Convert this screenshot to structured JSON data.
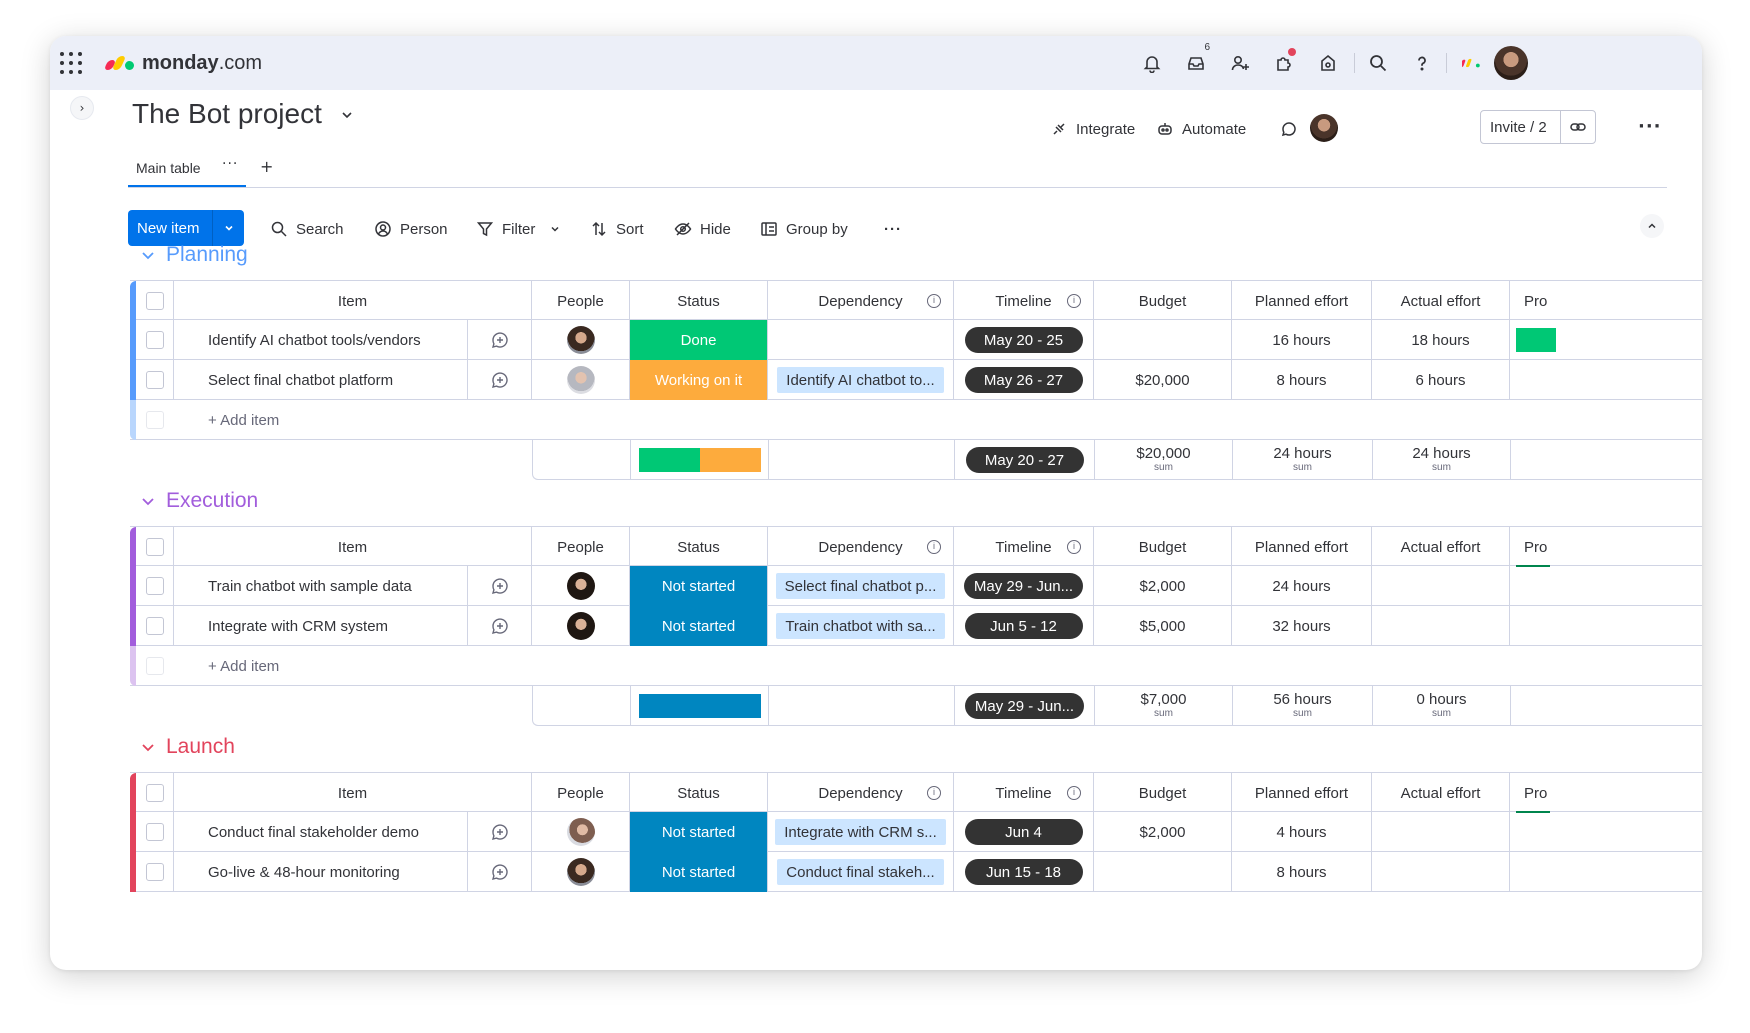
{
  "app": {
    "logo_text_bold": "monday",
    "logo_text_light": ".com",
    "inbox_badge": "6",
    "colors": {
      "brand_blue": "#0073ea",
      "done": "#00c875",
      "working": "#fdab3d",
      "not_started": "#0086c0"
    }
  },
  "board": {
    "title": "The Bot project",
    "tab_main": "Main table",
    "tab_dots": "···",
    "tab_add": "+",
    "integrate": "Integrate",
    "automate": "Automate",
    "invite": "Invite / 2",
    "more": "···"
  },
  "toolbar": {
    "new_item": "New item",
    "search": "Search",
    "person": "Person",
    "filter": "Filter",
    "sort": "Sort",
    "hide": "Hide",
    "group_by": "Group by",
    "more": "···"
  },
  "columns": {
    "item": "Item",
    "people": "People",
    "status": "Status",
    "dependency": "Dependency",
    "timeline": "Timeline",
    "budget": "Budget",
    "planned": "Planned effort",
    "actual": "Actual effort",
    "pro": "Pro"
  },
  "add_item": "+ Add item",
  "sum_label": "sum",
  "groups": [
    {
      "name": "Planning",
      "color": "#579bfc",
      "rows": [
        {
          "item": "Identify AI chatbot tools/vendors",
          "status": "Done",
          "status_color": "#00c875",
          "dependency": "",
          "timeline": "May 20 - 25",
          "budget": "",
          "planned": "16 hours",
          "actual": "18 hours"
        },
        {
          "item": "Select final chatbot platform",
          "status": "Working on it",
          "status_color": "#fdab3d",
          "dependency": "Identify AI chatbot to...",
          "timeline": "May 26 - 27",
          "budget": "$20,000",
          "planned": "8 hours",
          "actual": "6 hours"
        }
      ],
      "summary": {
        "timeline": "May 20 - 27",
        "budget": "$20,000",
        "planned": "24 hours",
        "actual": "24 hours",
        "status_split": [
          0.5,
          0.5
        ]
      }
    },
    {
      "name": "Execution",
      "color": "#a25ddc",
      "rows": [
        {
          "item": "Train chatbot with sample data",
          "status": "Not started",
          "status_color": "#0086c0",
          "dependency": "Select final chatbot p...",
          "timeline": "May 29 - Jun...",
          "budget": "$2,000",
          "planned": "24 hours",
          "actual": ""
        },
        {
          "item": "Integrate with CRM system",
          "status": "Not started",
          "status_color": "#0086c0",
          "dependency": "Train chatbot with sa...",
          "timeline": "Jun 5 - 12",
          "budget": "$5,000",
          "planned": "32 hours",
          "actual": ""
        }
      ],
      "summary": {
        "timeline": "May 29 - Jun...",
        "budget": "$7,000",
        "planned": "56 hours",
        "actual": "0 hours",
        "status_split": [
          1.0
        ]
      }
    },
    {
      "name": "Launch",
      "color": "#e2445c",
      "rows": [
        {
          "item": "Conduct final stakeholder demo",
          "status": "Not started",
          "status_color": "#0086c0",
          "dependency": "Integrate with CRM s...",
          "timeline": "Jun 4",
          "budget": "$2,000",
          "planned": "4 hours",
          "actual": ""
        },
        {
          "item": "Go-live & 48-hour monitoring",
          "status": "Not started",
          "status_color": "#0086c0",
          "dependency": "Conduct final stakeh...",
          "timeline": "Jun 15 - 18",
          "budget": "",
          "planned": "8 hours",
          "actual": ""
        }
      ]
    }
  ]
}
